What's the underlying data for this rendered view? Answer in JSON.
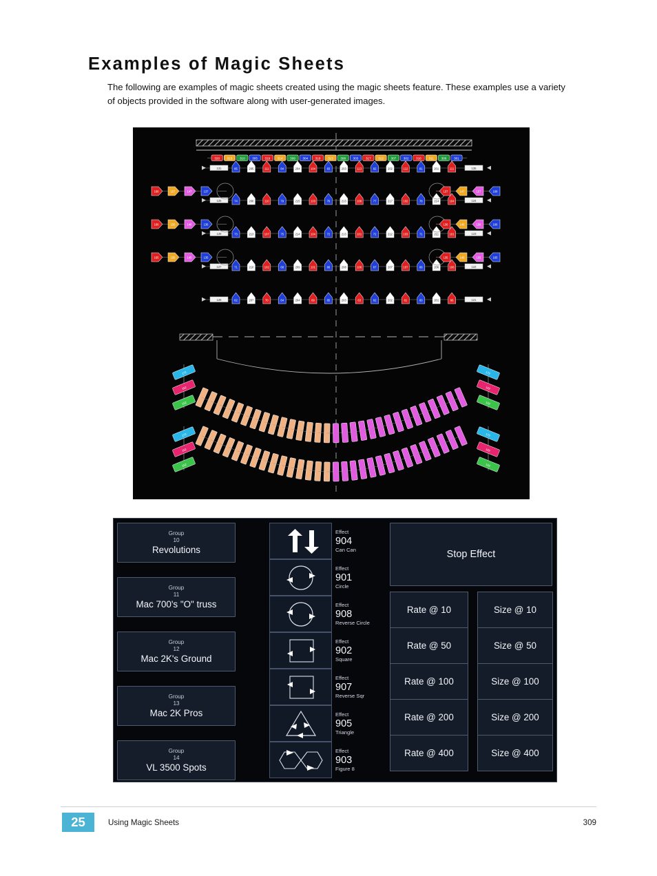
{
  "document": {
    "heading": "Examples of Magic Sheets",
    "intro": "The following are examples of magic sheets created using the magic sheets feature. These examples use a variety of objects provided in the software along with user-generated images."
  },
  "footer": {
    "chapter": "25",
    "title": "Using Magic Sheets",
    "page": "309"
  },
  "stage_plot": {
    "description": "Dark magic sheet showing a theatrical plot: overhead electric trusses with rows of numbered fixture symbols, side booms, proscenium apron curve and two curved floor fixture arcs.",
    "background": "#050505",
    "center_line_color": "#8d8d8d",
    "top_chip_row": {
      "labels": [
        "320",
        "313",
        "310",
        "305",
        "319",
        "314",
        "309",
        "304",
        "318",
        "313",
        "308",
        "303",
        "317",
        "312",
        "307",
        "302",
        "316",
        "311",
        "306",
        "301"
      ],
      "colors": [
        "#e02020",
        "#f0a823",
        "#1f9c3a",
        "#1f3fd8",
        "#e02020",
        "#f0a823",
        "#1f9c3a",
        "#1f3fd8",
        "#e02020",
        "#f0a823",
        "#1f9c3a",
        "#1f3fd8",
        "#e02020",
        "#f0a823",
        "#1f9c3a",
        "#1f3fd8",
        "#e02020",
        "#f0a823",
        "#1f9c3a",
        "#1f3fd8"
      ]
    },
    "electric_rows": [
      {
        "name": "electric-1",
        "left_bar": "131",
        "right_bar": "135",
        "fixtures": [
          "85",
          "205",
          "111",
          "84",
          "204",
          "104",
          "83",
          "203",
          "113",
          "82",
          "202",
          "112",
          "81",
          "201",
          "111"
        ]
      },
      {
        "name": "electric-2",
        "left_bar": "125",
        "right_bar": "124",
        "fixtures": [
          "74",
          "206",
          "110",
          "79",
          "215",
          "103",
          "76",
          "213",
          "108",
          "77",
          "217",
          "102",
          "78",
          "214",
          "104"
        ]
      },
      {
        "name": "electric-3",
        "left_bar": "128",
        "right_bar": "123",
        "fixtures": [
          "73",
          "213",
          "107",
          "75",
          "214",
          "104",
          "72",
          "213",
          "101",
          "72",
          "212",
          "103",
          "71",
          "211",
          "101"
        ]
      },
      {
        "name": "electric-4",
        "left_bar": "127",
        "right_bar": "122",
        "fixtures": [
          "71",
          "210",
          "102",
          "68",
          "209",
          "101",
          "68",
          "208",
          "106",
          "67",
          "207",
          "107",
          "66",
          "206",
          "106"
        ]
      },
      {
        "name": "electric-5",
        "left_bar": "126",
        "right_bar": "121",
        "fixtures": [
          "62",
          "207",
          "70",
          "64",
          "204",
          "69",
          "65",
          "203",
          "63",
          "62",
          "202",
          "61",
          "60",
          "201",
          "66"
        ]
      }
    ],
    "boom_rows": [
      {
        "name": "boom-1",
        "left": [
          "168",
          "157",
          "147",
          "137"
        ],
        "right": [
          "137",
          "147",
          "157",
          "168"
        ]
      },
      {
        "name": "boom-2",
        "left": [
          "166",
          "156",
          "146",
          "136"
        ],
        "right": [
          "136",
          "146",
          "156",
          "166"
        ]
      },
      {
        "name": "boom-3",
        "left": [
          "165",
          "155",
          "145",
          "135"
        ],
        "right": [
          "135",
          "145",
          "155",
          "165"
        ]
      }
    ],
    "side_ladders": {
      "colors": [
        "#29b6e8",
        "#e8246e",
        "#3bc449"
      ],
      "labels": [
        "172",
        "162",
        "152"
      ]
    },
    "floor_arcs": {
      "left_color": "#f0b283",
      "right_color": "#e25be0",
      "rows": 2,
      "per_row": 30
    }
  },
  "magic_sheet": {
    "groups": [
      {
        "kind": "Group",
        "number": "10",
        "label": "Revolutions"
      },
      {
        "kind": "Group",
        "number": "11",
        "label": "Mac 700's \"O\" truss"
      },
      {
        "kind": "Group",
        "number": "12",
        "label": "Mac 2K's Ground"
      },
      {
        "kind": "Group",
        "number": "13",
        "label": "Mac 2K Pros"
      },
      {
        "kind": "Group",
        "number": "14",
        "label": "VL 3500 Spots"
      }
    ],
    "effects": [
      {
        "kind": "Effect",
        "number": "904",
        "name": "Can Can",
        "icon": "up-down-arrows-icon"
      },
      {
        "kind": "Effect",
        "number": "901",
        "name": "Circle",
        "icon": "circle-clockwise-icon"
      },
      {
        "kind": "Effect",
        "number": "908",
        "name": "Reverse Circle",
        "icon": "circle-counterclockwise-icon"
      },
      {
        "kind": "Effect",
        "number": "902",
        "name": "Square",
        "icon": "square-clockwise-icon"
      },
      {
        "kind": "Effect",
        "number": "907",
        "name": "Reverse Sqr",
        "icon": "square-counterclockwise-icon"
      },
      {
        "kind": "Effect",
        "number": "905",
        "name": "Triangle",
        "icon": "triangle-path-icon"
      },
      {
        "kind": "Effect",
        "number": "903",
        "name": "Figure 8",
        "icon": "figure-eight-icon"
      }
    ],
    "stop_effect": "Stop Effect",
    "rate_buttons": [
      "Rate @ 10",
      "Rate @ 50",
      "Rate @ 100",
      "Rate @ 200",
      "Rate @ 400"
    ],
    "size_buttons": [
      "Size @ 10",
      "Size @ 50",
      "Size @ 100",
      "Size @ 200",
      "Size @ 400"
    ],
    "colors": {
      "panel_bg": "#05070b",
      "panel_border": "#3d4654",
      "button_bg": "#151d2b",
      "button_border": "#4e5a6d",
      "text": "#f2f5f9"
    }
  }
}
